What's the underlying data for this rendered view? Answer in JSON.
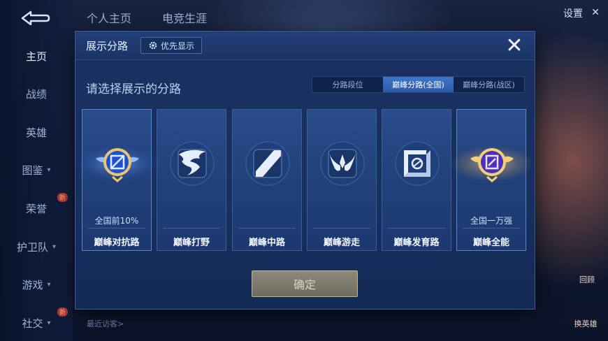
{
  "background": {
    "nav_items": [
      {
        "label": "主页",
        "active": true,
        "chevron": false,
        "badge": ""
      },
      {
        "label": "战绩",
        "active": false,
        "chevron": false,
        "badge": ""
      },
      {
        "label": "英雄",
        "active": false,
        "chevron": false,
        "badge": ""
      },
      {
        "label": "图鉴",
        "active": false,
        "chevron": true,
        "badge": ""
      },
      {
        "label": "荣誉",
        "active": false,
        "chevron": false,
        "badge": "新"
      },
      {
        "label": "护卫队",
        "active": false,
        "chevron": true,
        "badge": ""
      },
      {
        "label": "游戏",
        "active": false,
        "chevron": true,
        "badge": ""
      },
      {
        "label": "社交",
        "active": false,
        "chevron": true,
        "badge": "新"
      }
    ],
    "tabs": [
      "个人主页",
      "电竞生涯"
    ],
    "settings_label": "设置",
    "recent_visitors_label": "最近访客>",
    "right_buttons": [
      "回顾",
      "换英雄"
    ]
  },
  "modal": {
    "title": "展示分路",
    "priority_button": "优先显示",
    "close_icon": "close-icon",
    "prompt": "请选择展示的分路",
    "segments": [
      {
        "label": "分路段位",
        "selected": false
      },
      {
        "label": "巅峰分路(全国)",
        "selected": true
      },
      {
        "label": "巅峰分路(战区)",
        "selected": false
      }
    ],
    "cards": [
      {
        "name": "巅峰对抗路",
        "rank": "全国前10%",
        "icon": "badge-blue-icon",
        "active": true
      },
      {
        "name": "巅峰打野",
        "rank": "",
        "icon": "jungle-dragon-icon",
        "active": false
      },
      {
        "name": "巅峰中路",
        "rank": "",
        "icon": "mid-lane-icon",
        "active": false
      },
      {
        "name": "巅峰游走",
        "rank": "",
        "icon": "support-wings-icon",
        "active": false
      },
      {
        "name": "巅峰发育路",
        "rank": "",
        "icon": "adc-lane-icon",
        "active": false
      },
      {
        "name": "巅峰全能",
        "rank": "全国一万强",
        "icon": "badge-purple-icon",
        "active": true
      }
    ],
    "confirm_button": "确定"
  },
  "colors": {
    "accent_blue": "#3f77c9",
    "gold": "#c7b47f",
    "panel": "#17305f"
  }
}
